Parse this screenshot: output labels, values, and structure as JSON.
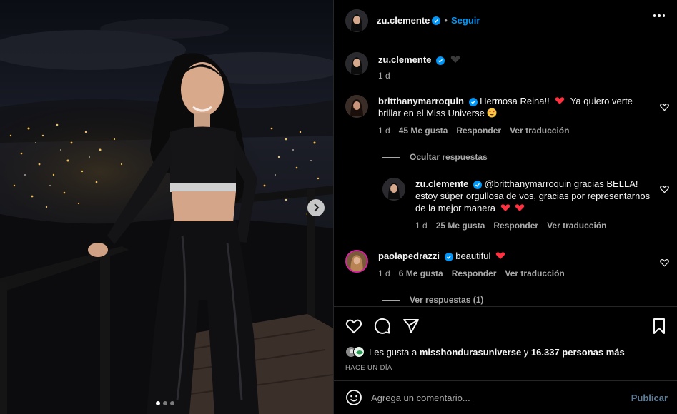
{
  "post": {
    "author": "zu.clemente",
    "follow_label": "Seguir",
    "separator": "•",
    "carousel": {
      "current": 1,
      "total": 3
    }
  },
  "caption": {
    "username": "zu.clemente",
    "time": "1 d"
  },
  "comments": [
    {
      "username": "britthanymarroquin",
      "text_part1": "Hermosa Reina!!",
      "text_part2": "Ya quiero verte brillar en el Miss Universe",
      "time": "1 d",
      "likes": "45 Me gusta",
      "reply_label": "Responder",
      "translate_label": "Ver traducción"
    },
    {
      "username": "zu.clemente",
      "text": "@britthanymarroquin gracias BELLA! estoy súper orgullosa de vos, gracias por representarnos de la mejor manera",
      "time": "1 d",
      "likes": "25 Me gusta",
      "reply_label": "Responder",
      "translate_label": "Ver traducción"
    },
    {
      "username": "paolapedrazzi",
      "text": "beautiful",
      "time": "1 d",
      "likes": "6 Me gusta",
      "reply_label": "Responder",
      "translate_label": "Ver traducción"
    }
  ],
  "hide_replies_label": "Ocultar respuestas",
  "view_replies_label": "Ver respuestas (1)",
  "likes": {
    "prefix": "Les gusta a",
    "user": "misshondurasuniverse",
    "middle": "y",
    "count": "16.337 personas más"
  },
  "time_ago": "HACE UN DÍA",
  "comment_box": {
    "placeholder": "Agrega un comentario...",
    "publish_label": "Publicar"
  },
  "colors": {
    "accent": "#0095f6",
    "heart": "#ff3040",
    "muted": "#a8a8a8",
    "border": "#262626"
  }
}
